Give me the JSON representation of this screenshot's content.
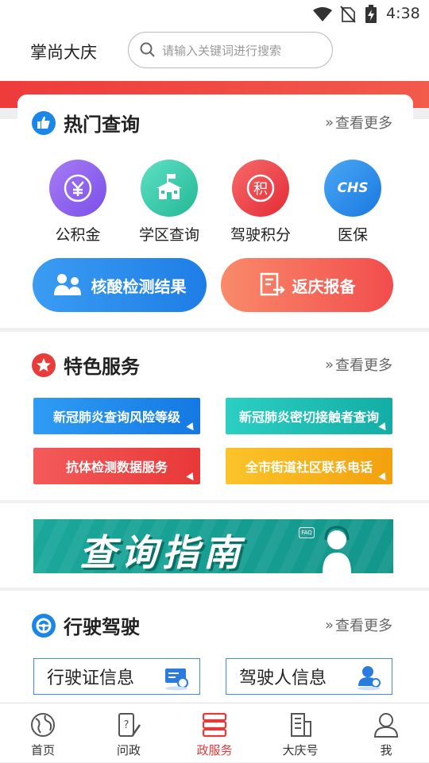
{
  "status_bar": {
    "time": "4:38"
  },
  "header": {
    "app_title": "掌尚大庆",
    "search_placeholder": "请输入关键词进行搜索"
  },
  "hot_query": {
    "title": "热门查询",
    "more": "查看更多",
    "items": [
      {
        "label": "公积金",
        "icon": "provident-fund-icon",
        "color": "#8a5cf0"
      },
      {
        "label": "学区查询",
        "icon": "school-icon",
        "color": "#2fc7a6"
      },
      {
        "label": "驾驶积分",
        "icon": "driving-points-icon",
        "color": "#ea3b43"
      },
      {
        "label": "医保",
        "icon": "medical-insurance-icon",
        "color": "#2a8fe8",
        "badge": "CHS"
      }
    ],
    "buttons": [
      {
        "label": "核酸检测结果",
        "icon": "nucleic-test-icon"
      },
      {
        "label": "返庆报备",
        "icon": "report-icon"
      }
    ]
  },
  "featured": {
    "title": "特色服务",
    "more": "查看更多",
    "items": [
      {
        "label": "新冠肺炎查询风险等级",
        "color": "#1e8ff0"
      },
      {
        "label": "新冠肺炎密切接触者查询",
        "color": "#1fbcb4"
      },
      {
        "label": "抗体检测数据服务",
        "color": "#f04b4b"
      },
      {
        "label": "全市街道社区联系电话",
        "color": "#f7b21a"
      }
    ]
  },
  "banner": {
    "text": "查询指南",
    "badge": "FAQ"
  },
  "driving": {
    "title": "行驶驾驶",
    "more": "查看更多",
    "items": [
      {
        "label": "行驶证信息",
        "icon": "vehicle-license-icon"
      },
      {
        "label": "驾驶人信息",
        "icon": "driver-icon"
      }
    ]
  },
  "tabbar": {
    "items": [
      {
        "label": "首页",
        "icon": "globe-icon"
      },
      {
        "label": "问政",
        "icon": "question-pen-icon"
      },
      {
        "label": "政服务",
        "icon": "server-icon",
        "active": true
      },
      {
        "label": "大庆号",
        "icon": "building-icon"
      },
      {
        "label": "我",
        "icon": "person-icon"
      }
    ]
  }
}
